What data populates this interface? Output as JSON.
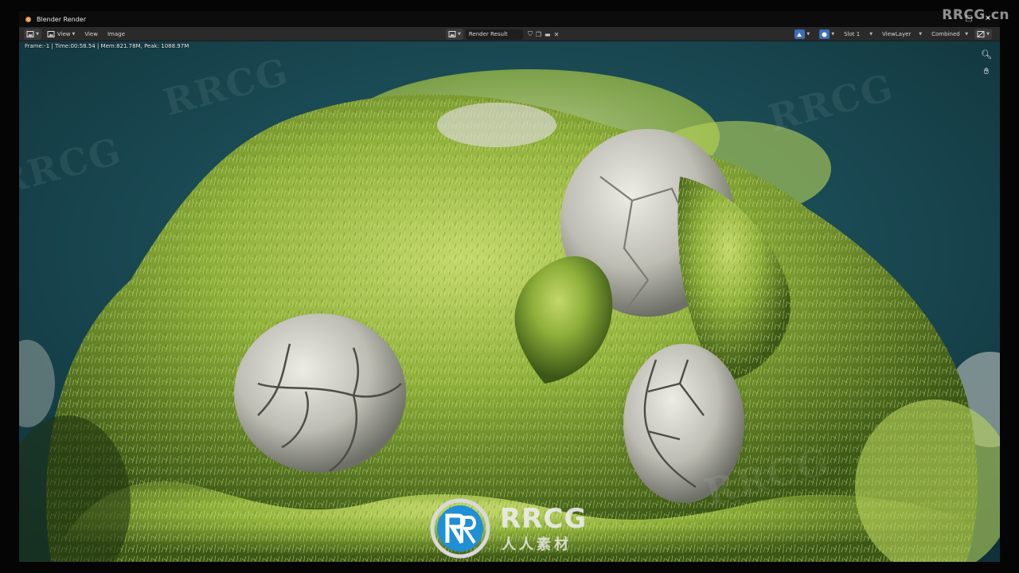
{
  "window": {
    "title": "Blender Render",
    "controls": [
      "–",
      "□",
      "✕"
    ]
  },
  "header": {
    "menus": [
      "View",
      "View",
      "Image"
    ],
    "render_result": "Render Result",
    "slot": "Slot 1",
    "view_layer": "ViewLayer",
    "pass": "Combined"
  },
  "viewport": {
    "stats": "Frame:-1 | Time:00:58.54 | Mem:821.78M, Peak: 1088.97M",
    "background_color": "#1b4b55"
  },
  "watermark": {
    "corner": "RRCG.cn",
    "text": "RRCG",
    "logo_text": "RRCG",
    "logo_sub": "人人素材"
  },
  "colors": {
    "moss_light": "#b8d35a",
    "moss_mid": "#7fa032",
    "moss_dark": "#3d5a18",
    "stone": "#c9c9c2",
    "accent_blue": "#3c6db7"
  }
}
